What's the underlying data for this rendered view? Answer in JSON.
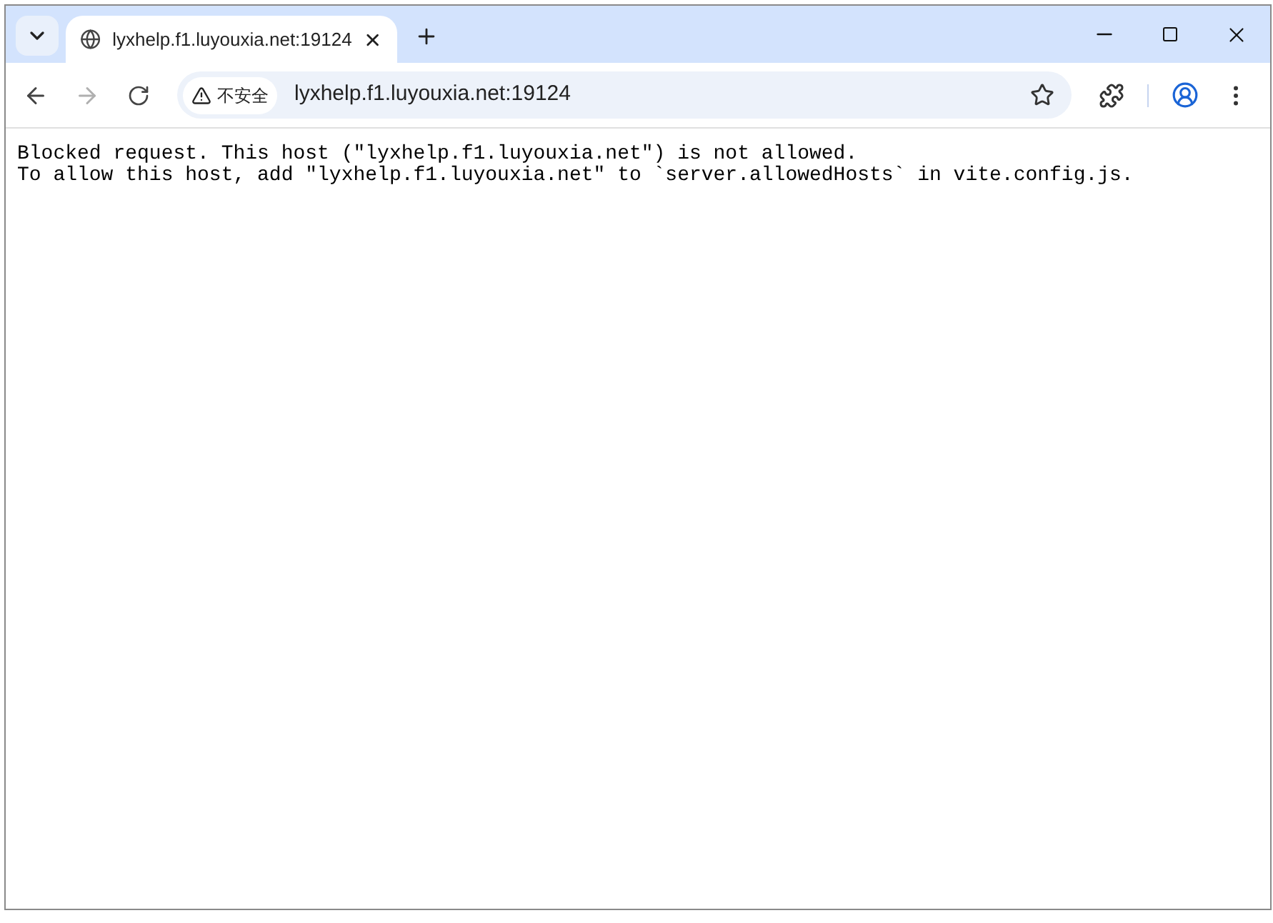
{
  "tab": {
    "title": "lyxhelp.f1.luyouxia.net:19124",
    "selected": true
  },
  "toolbar": {
    "back_disabled": false,
    "forward_disabled": true,
    "security_label": "不安全",
    "address": "lyxhelp.f1.luyouxia.net:19124"
  },
  "page": {
    "lines": [
      "Blocked request. This host (\"lyxhelp.f1.luyouxia.net\") is not allowed.",
      "To allow this host, add \"lyxhelp.f1.luyouxia.net\" to `server.allowedHosts` in vite.config.js."
    ]
  }
}
